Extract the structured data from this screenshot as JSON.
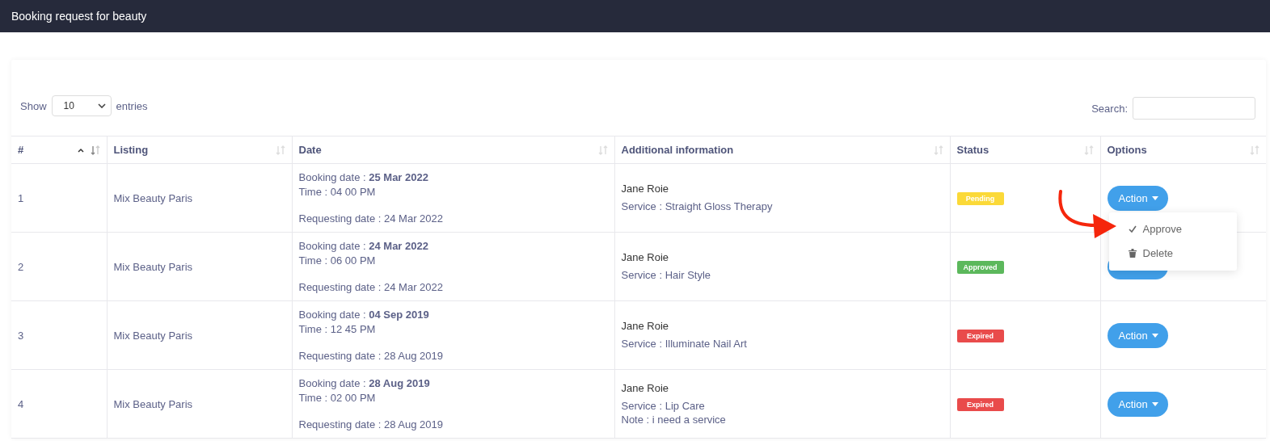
{
  "header": {
    "title": "Booking request for beauty"
  },
  "length_control": {
    "before": "Show",
    "value": "10",
    "after": "entries"
  },
  "search": {
    "label": "Search:"
  },
  "columns": [
    {
      "label": "#",
      "sorted": true
    },
    {
      "label": "Listing",
      "sorted": false
    },
    {
      "label": "Date",
      "sorted": false
    },
    {
      "label": "Additional information",
      "sorted": false
    },
    {
      "label": "Status",
      "sorted": false
    },
    {
      "label": "Options",
      "sorted": false
    }
  ],
  "rows": [
    {
      "number": "1",
      "listing": "Mix Beauty Paris",
      "booking": "Booking date : **25 Mar 2022**",
      "time": "Time : 04 00 PM",
      "requesting": "Requesting date : 24 Mar 2022",
      "name": "Jane Roie",
      "details": [
        "Service : Straight Gloss Therapy"
      ],
      "status": {
        "label": "Pending",
        "color": "#fbd938"
      },
      "action": "Action",
      "menu_open": true
    },
    {
      "number": "2",
      "listing": "Mix Beauty Paris",
      "booking": "Booking date : **24 Mar 2022**",
      "time": "Time : 06 00 PM",
      "requesting": "Requesting date : 24 Mar 2022",
      "name": "Jane Roie",
      "details": [
        "Service : Hair Style"
      ],
      "status": {
        "label": "Approved",
        "color": "#5cb85c"
      },
      "menu_open": false
    },
    {
      "number": "3",
      "listing": "Mix Beauty Paris",
      "booking": "Booking date : **04 Sep 2019**",
      "time": "Time : 12 45 PM",
      "requesting": "Requesting date : 28 Aug 2019",
      "name": "Jane Roie",
      "details": [
        "Service : Illuminate Nail Art"
      ],
      "status": {
        "label": "Expired",
        "color": "#e94b4b"
      },
      "action": "Action",
      "menu_open": false
    },
    {
      "number": "4",
      "listing": "Mix Beauty Paris",
      "booking": "Booking date : **28 Aug 2019**",
      "time": "Time : 02 00 PM",
      "requesting": "Requesting date : 28 Aug 2019",
      "name": "Jane Roie",
      "details": [
        "Service : Lip Care",
        "Note : i need a service"
      ],
      "status": {
        "label": "Expired",
        "color": "#e94b4b"
      },
      "action": "Action",
      "menu_open": false
    }
  ],
  "action_menu": [
    {
      "kind": "check",
      "label": "Approve"
    },
    {
      "kind": "trash",
      "label": "Delete"
    }
  ]
}
